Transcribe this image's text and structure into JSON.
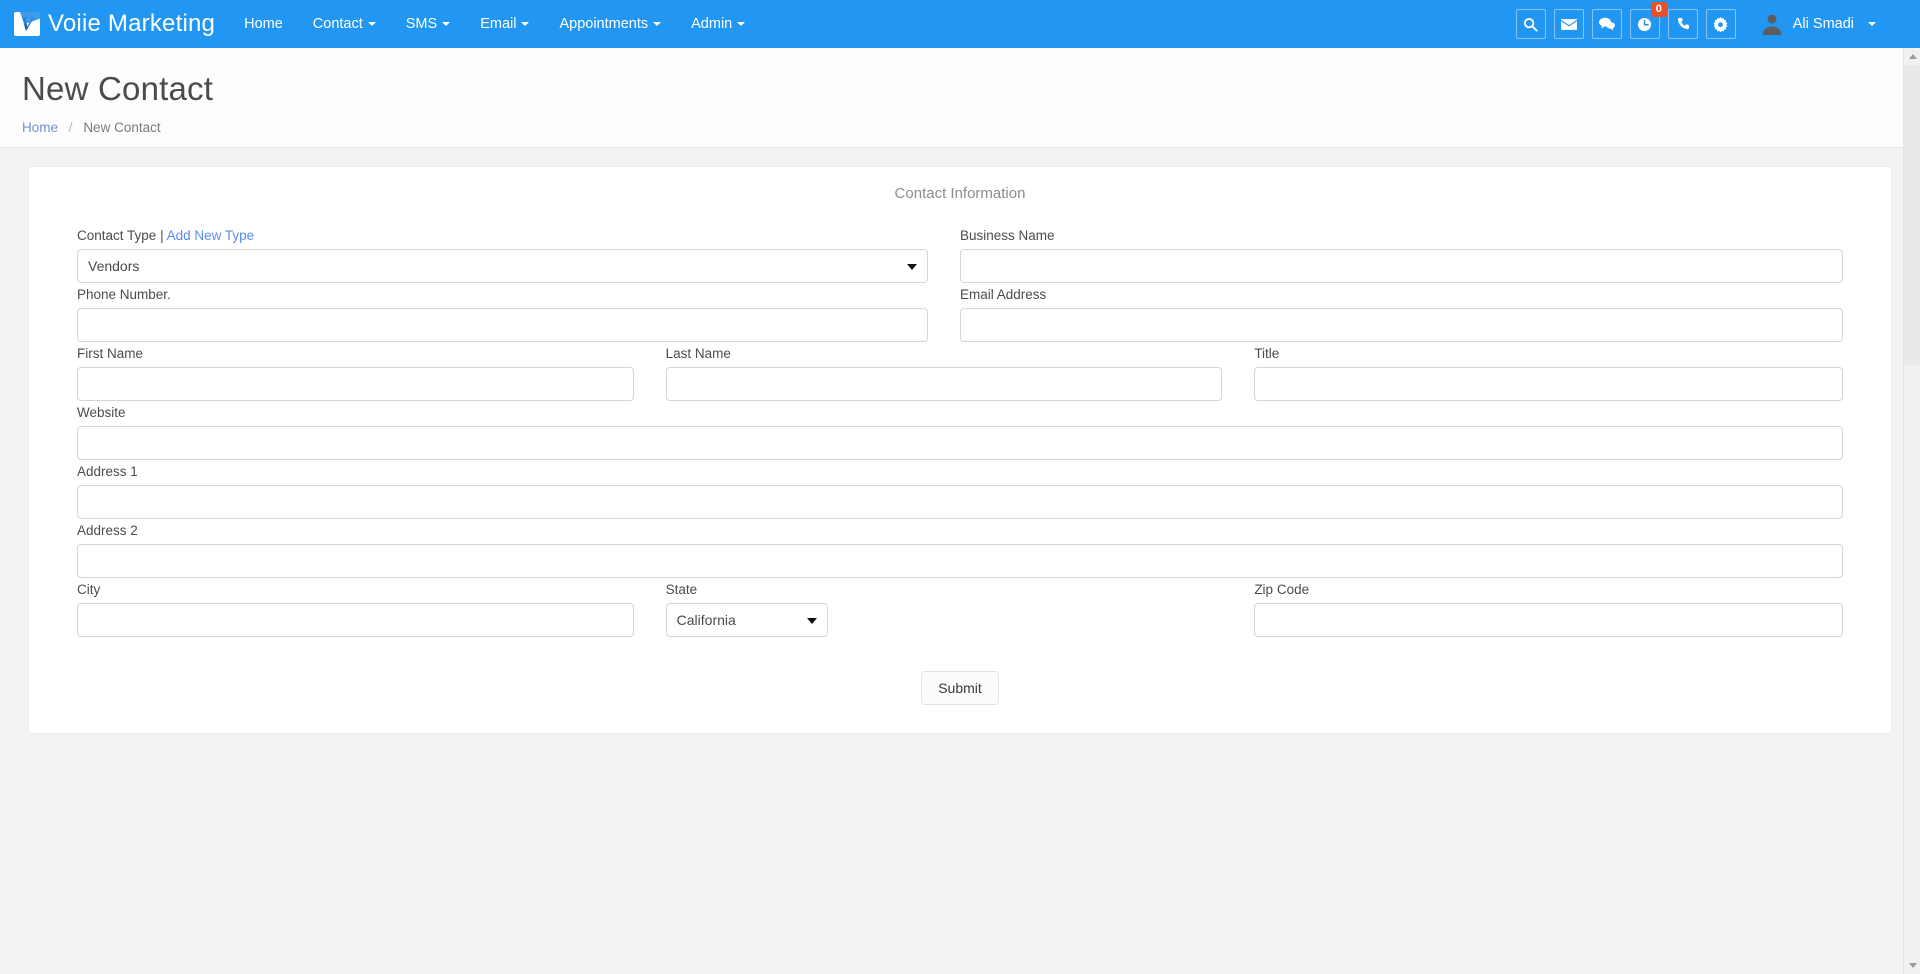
{
  "navbar": {
    "brand": "Voiie Marketing",
    "brand_icon": "voiie-v-logo-icon",
    "links": [
      {
        "label": "Home",
        "has_caret": false
      },
      {
        "label": "Contact",
        "has_caret": true
      },
      {
        "label": "SMS",
        "has_caret": true
      },
      {
        "label": "Email",
        "has_caret": true
      },
      {
        "label": "Appointments",
        "has_caret": true
      },
      {
        "label": "Admin",
        "has_caret": true
      }
    ],
    "icons": [
      {
        "name": "search-icon"
      },
      {
        "name": "envelope-icon"
      },
      {
        "name": "comments-icon"
      },
      {
        "name": "clock-icon",
        "badge": "0"
      },
      {
        "name": "phone-icon"
      },
      {
        "name": "gear-icon"
      }
    ],
    "user": {
      "name": "Ali Smadi",
      "avatar": "user-avatar-icon"
    },
    "accent_color": "#2196f3",
    "badge_color": "#e8502a"
  },
  "page": {
    "title": "New Contact",
    "breadcrumb": {
      "home": "Home",
      "separator": "/",
      "current": "New Contact"
    }
  },
  "form": {
    "card_title": "Contact Information",
    "contact_type": {
      "label_main": "Contact Type",
      "pipe": "|",
      "add_link": "Add New Type",
      "value": "Vendors",
      "options": [
        "Vendors"
      ]
    },
    "business_name": {
      "label": "Business Name",
      "value": ""
    },
    "phone_number": {
      "label": "Phone Number.",
      "value": ""
    },
    "email_address": {
      "label": "Email Address",
      "value": ""
    },
    "first_name": {
      "label": "First Name",
      "value": ""
    },
    "last_name": {
      "label": "Last Name",
      "value": ""
    },
    "title": {
      "label": "Title",
      "value": ""
    },
    "website": {
      "label": "Website",
      "value": ""
    },
    "address1": {
      "label": "Address 1",
      "value": ""
    },
    "address2": {
      "label": "Address 2",
      "value": ""
    },
    "city": {
      "label": "City",
      "value": ""
    },
    "state": {
      "label": "State",
      "value": "California",
      "options": [
        "California"
      ]
    },
    "zip_code": {
      "label": "Zip Code",
      "value": ""
    },
    "submit": {
      "label": "Submit"
    }
  }
}
